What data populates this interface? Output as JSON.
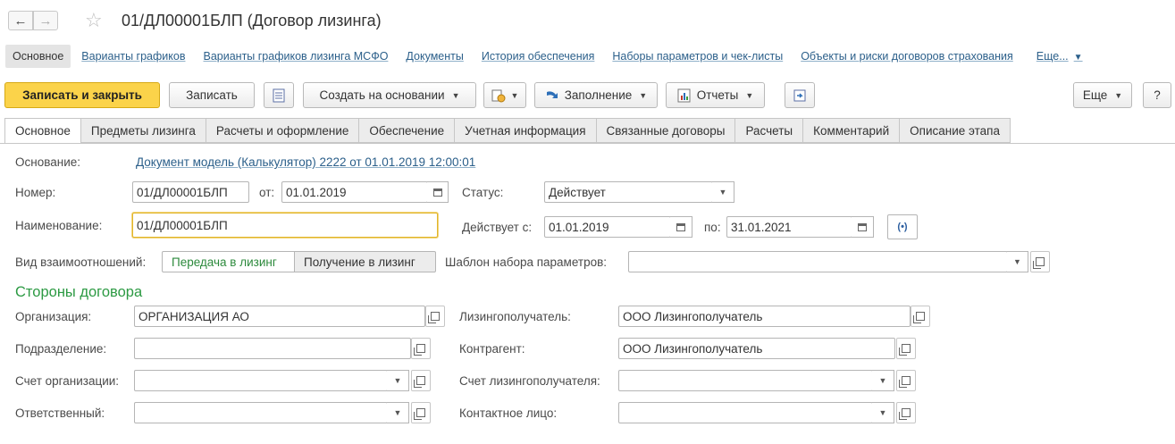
{
  "title": "01/ДЛ00001БЛП (Договор лизинга)",
  "icons": {
    "back": "arrow-left-icon",
    "forward": "arrow-right-icon",
    "favorite": "star-icon"
  },
  "sections": {
    "active": "Основное",
    "links": [
      "Варианты графиков",
      "Варианты графиков лизинга МСФО",
      "Документы",
      "История обеспечения",
      "Наборы параметров  и чек-листы",
      "Объекты и риски договоров страхования"
    ],
    "more": "Еще..."
  },
  "toolbar": {
    "save_close": "Записать и закрыть",
    "save": "Записать",
    "create_based": "Создать на основании",
    "fill": "Заполнение",
    "reports": "Отчеты",
    "more": "Еще",
    "help": "?"
  },
  "tabs": [
    "Основное",
    "Предметы лизинга",
    "Расчеты и оформление",
    "Обеспечение",
    "Учетная информация",
    "Связанные договоры",
    "Расчеты",
    "Комментарий",
    "Описание этапа"
  ],
  "form": {
    "basis_label": "Основание:",
    "basis_link": "Документ модель (Калькулятор) 2222 от 01.01.2019 12:00:01",
    "number_label": "Номер:",
    "number_value": "01/ДЛ00001БЛП",
    "from_label": "от:",
    "from_date": "01.01.2019",
    "status_label": "Статус:",
    "status_value": "Действует",
    "name_label": "Наименование:",
    "name_value": "01/ДЛ00001БЛП",
    "valid_from_label": "Действует с:",
    "valid_from": "01.01.2019",
    "to_label": "по:",
    "valid_to": "31.01.2021",
    "relation_label": "Вид взаимоотношений:",
    "relation_options": [
      "Передача в лизинг",
      "Получение в лизинг"
    ],
    "relation_selected": "Передача в лизинг",
    "template_label": "Шаблон набора параметров:",
    "template_value": "",
    "parties_title": "Стороны договора",
    "org_label": "Организация:",
    "org_value": "ОРГАНИЗАЦИЯ АО",
    "lessee_label": "Лизингополучатель:",
    "lessee_value": "ООО Лизингополучатель",
    "dept_label": "Подразделение:",
    "dept_value": "",
    "counterparty_label": "Контрагент:",
    "counterparty_value": "ООО Лизингополучатель",
    "org_account_label": "Счет организации:",
    "org_account_value": "",
    "lessee_account_label": "Счет лизингополучателя:",
    "lessee_account_value": "",
    "responsible_label": "Ответственный:",
    "responsible_value": "",
    "contact_label": "Контактное лицо:",
    "contact_value": ""
  }
}
